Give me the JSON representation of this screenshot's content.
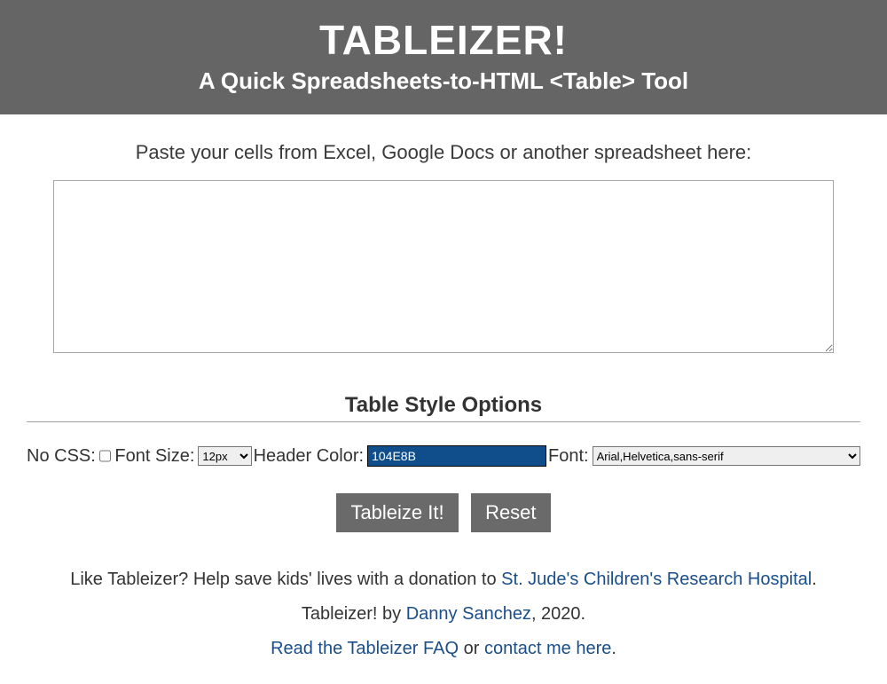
{
  "header": {
    "title": "TABLEIZER!",
    "subtitle": "A Quick Spreadsheets-to-HTML <Table> Tool"
  },
  "prompt": "Paste your cells from Excel, Google Docs or another spreadsheet here:",
  "textarea_value": "",
  "options": {
    "title": "Table Style Options",
    "no_css_label": "No CSS: ",
    "font_size_label": "Font Size: ",
    "font_size_value": "12px",
    "header_color_label": "Header Color: ",
    "header_color_value": "104E8B",
    "font_label": "Font: ",
    "font_value": "Arial,Helvetica,sans-serif"
  },
  "buttons": {
    "submit": "Tableize It!",
    "reset": "Reset"
  },
  "footer": {
    "like_prefix": "Like Tableizer? Help save kids' lives with a donation to ",
    "stjude": "St. Jude's Children's Research Hospital",
    "period1": ".",
    "byline_prefix": "Tableizer! by ",
    "author": "Danny Sanchez",
    "byline_suffix": ", 2020.",
    "faq_link": "Read the Tableizer FAQ",
    "or": " or ",
    "contact_link": "contact me here",
    "period2": "."
  }
}
